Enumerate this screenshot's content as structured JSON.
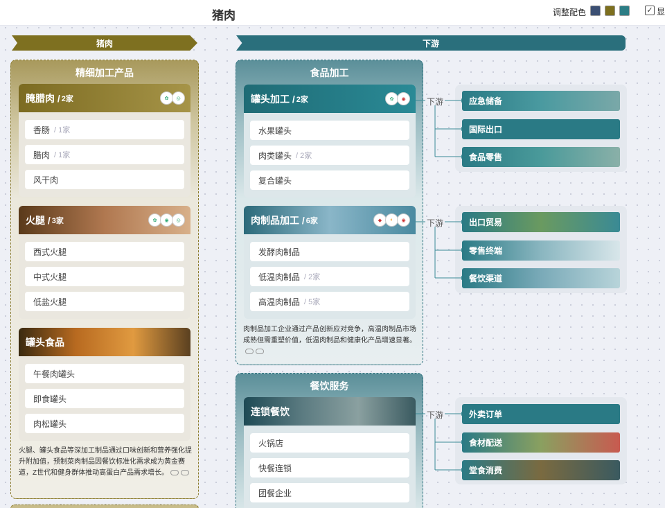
{
  "header": {
    "title": "猪肉",
    "adjust_color": "调整配色",
    "show_label": "显",
    "swatches": [
      "#3b4f73",
      "#7d6f1e",
      "#2c7d85"
    ]
  },
  "left": {
    "banner": "猪肉",
    "group_title": "精细加工产品",
    "cards": [
      {
        "title": "腌腊肉 / ",
        "count": "2家",
        "items": [
          {
            "name": "香肠",
            "count": "/ 1家"
          },
          {
            "name": "腊肉",
            "count": "/ 1家"
          },
          {
            "name": "风干肉",
            "count": ""
          }
        ]
      },
      {
        "title": "火腿 / ",
        "count": "3家",
        "items": [
          {
            "name": "西式火腿",
            "count": ""
          },
          {
            "name": "中式火腿",
            "count": ""
          },
          {
            "name": "低盐火腿",
            "count": ""
          }
        ]
      },
      {
        "title": "罐头食品",
        "count": "",
        "items": [
          {
            "name": "午餐肉罐头",
            "count": ""
          },
          {
            "name": "即食罐头",
            "count": ""
          },
          {
            "name": "肉松罐头",
            "count": ""
          }
        ]
      }
    ],
    "desc": "火腿、罐头食品等深加工制品通过口味创新和营养强化提升附加值，预制菜肉制品因餐饮标准化需求成为黄金赛道，Z世代和健身群体推动高蛋白产品需求增长。"
  },
  "right": {
    "banner": "下游",
    "downstream_label": "下游",
    "food_group": {
      "title": "食品加工",
      "cards": [
        {
          "title": "罐头加工 / ",
          "count": "2家",
          "items": [
            {
              "name": "水果罐头",
              "count": ""
            },
            {
              "name": "肉类罐头",
              "count": "/ 2家"
            },
            {
              "name": "复合罐头",
              "count": ""
            }
          ]
        },
        {
          "title": "肉制品加工 / ",
          "count": "6家",
          "items": [
            {
              "name": "发酵肉制品",
              "count": ""
            },
            {
              "name": "低温肉制品",
              "count": "/ 2家"
            },
            {
              "name": "高温肉制品",
              "count": "/ 5家"
            }
          ]
        }
      ],
      "desc": "肉制品加工企业通过产品创新应对竞争，高温肉制品市场成熟但需重塑价值，低温肉制品和健康化产品增速显著。"
    },
    "catering_group": {
      "title": "餐饮服务",
      "cards": [
        {
          "title": "连锁餐饮",
          "count": "",
          "items": [
            {
              "name": "火锅店",
              "count": ""
            },
            {
              "name": "快餐连锁",
              "count": ""
            },
            {
              "name": "团餐企业",
              "count": ""
            }
          ]
        }
      ]
    },
    "downstream": [
      [
        "应急储备",
        "国际出口",
        "食品零售"
      ],
      [
        "出口贸易",
        "零售终端",
        "餐饮渠道"
      ],
      [
        "外卖订单",
        "食材配送",
        "堂食消费"
      ]
    ]
  }
}
